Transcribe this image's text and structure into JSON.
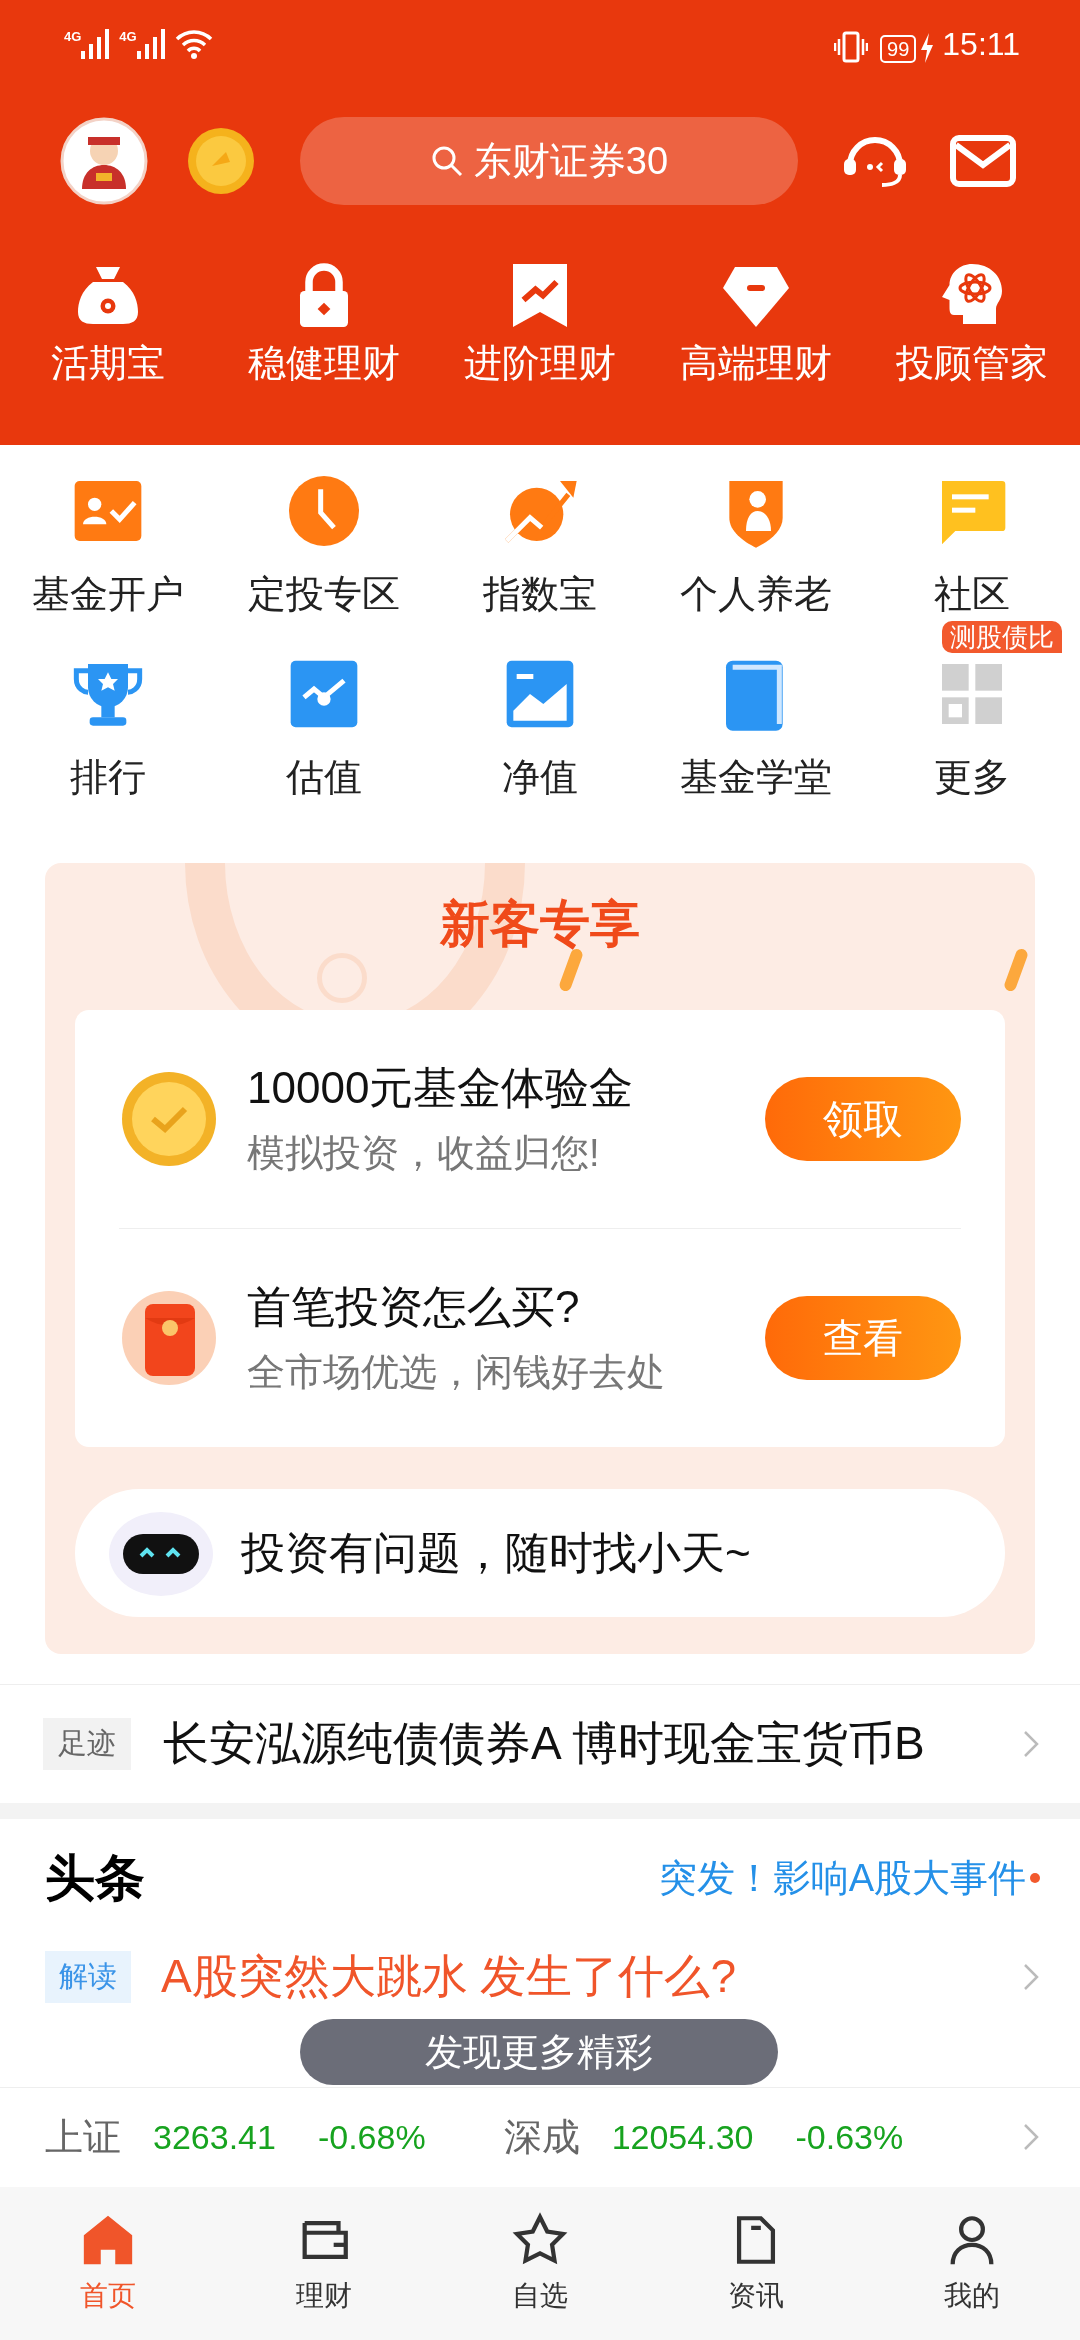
{
  "status_bar": {
    "network_1": "4G",
    "network_2": "4G",
    "battery": "99",
    "time": "15:11"
  },
  "header": {
    "search": {
      "placeholder": "东财证券30"
    }
  },
  "top_menu": [
    {
      "label": "活期宝"
    },
    {
      "label": "稳健理财"
    },
    {
      "label": "进阶理财"
    },
    {
      "label": "高端理财"
    },
    {
      "label": "投顾管家"
    }
  ],
  "shortcuts": [
    {
      "label": "基金开户"
    },
    {
      "label": "定投专区"
    },
    {
      "label": "指数宝"
    },
    {
      "label": "个人养老"
    },
    {
      "label": "社区"
    },
    {
      "label": "排行"
    },
    {
      "label": "估值"
    },
    {
      "label": "净值"
    },
    {
      "label": "基金学堂"
    },
    {
      "label": "更多",
      "badge": "测股债比"
    }
  ],
  "promo": {
    "title": "新客专享",
    "offers": [
      {
        "kind": "coin",
        "title": "10000元基金体验金",
        "subtitle": "模拟投资，收益归您!",
        "button": "领取"
      },
      {
        "kind": "envelope",
        "title": "首笔投资怎么买?",
        "subtitle": "全市场优选，闲钱好去处",
        "button": "查看"
      }
    ],
    "assistant": "投资有问题，随时找小天~"
  },
  "footprint": {
    "tag": "足迹",
    "text": "长安泓源纯债债券A 博时现金宝货币B"
  },
  "headlines": {
    "title": "头条",
    "breaking": "突发！影响A股大事件",
    "tag": "解读",
    "headline": "A股突然大跳水 发生了什么?",
    "toast": "发现更多精彩"
  },
  "indices": [
    {
      "name": "上证",
      "value": "3263.41",
      "change": "-0.68%"
    },
    {
      "name": "深成",
      "value": "12054.30",
      "change": "-0.63%"
    }
  ],
  "tab_bar": [
    {
      "label": "首页",
      "selected": true
    },
    {
      "label": "理财",
      "selected": false
    },
    {
      "label": "自选",
      "selected": false
    },
    {
      "label": "资讯",
      "selected": false
    },
    {
      "label": "我的",
      "selected": false
    }
  ]
}
